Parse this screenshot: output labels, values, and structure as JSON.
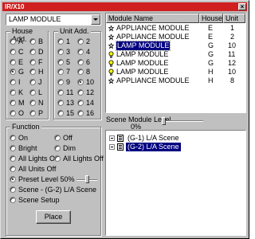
{
  "window": {
    "title": "IR/X10",
    "close_glyph": "×"
  },
  "module_selector": {
    "value": "LAMP MODULE"
  },
  "house_address": {
    "legend": "House Add.",
    "options": [
      "A",
      "B",
      "C",
      "D",
      "E",
      "F",
      "G",
      "H",
      "I",
      "J",
      "K",
      "L",
      "M",
      "N",
      "O",
      "P"
    ],
    "selected": "G"
  },
  "unit_address": {
    "legend": "Unit Add.",
    "options": [
      "1",
      "2",
      "3",
      "4",
      "5",
      "6",
      "7",
      "8",
      "9",
      "10",
      "11",
      "12",
      "13",
      "14",
      "15",
      "16"
    ],
    "selected": "10"
  },
  "function": {
    "legend": "Function",
    "on": "On",
    "off": "Off",
    "bright": "Bright",
    "dim": "Dim",
    "all_lights_on": "All Lights On",
    "all_lights_off": "All Lights Off",
    "all_units_off": "All Units Off",
    "preset_level": "Preset Level 50%",
    "preset_level_value": 50,
    "scene": "Scene - (G-2) L/A Scene",
    "scene_setup": "Scene Setup",
    "selected": "preset_level"
  },
  "place_button": "Place",
  "module_list": {
    "columns": [
      "Module Name",
      "House",
      "Unit"
    ],
    "rows": [
      {
        "icon": "appliance-icon",
        "name": "APPLIANCE MODULE",
        "house": "E",
        "unit": "1"
      },
      {
        "icon": "appliance-icon",
        "name": "APPLIANCE MODULE",
        "house": "E",
        "unit": "2"
      },
      {
        "icon": "appliance-icon",
        "name": "LAMP MODULE",
        "house": "G",
        "unit": "10",
        "selected": true
      },
      {
        "icon": "lamp-icon",
        "name": "LAMP MODULE",
        "house": "G",
        "unit": "11"
      },
      {
        "icon": "lamp-icon",
        "name": "LAMP MODULE",
        "house": "G",
        "unit": "12"
      },
      {
        "icon": "lamp-icon",
        "name": "LAMP MODULE",
        "house": "H",
        "unit": "10"
      },
      {
        "icon": "appliance-icon",
        "name": "APPLIANCE MODULE",
        "house": "H",
        "unit": "8"
      }
    ]
  },
  "scene_module_level": {
    "label": "Scene Module Level",
    "value": "0%",
    "level": 0
  },
  "scene_tree": {
    "items": [
      {
        "label": "(G-1) L/A Scene",
        "selected": false
      },
      {
        "label": "(G-2) L/A Scene",
        "selected": true
      }
    ]
  }
}
